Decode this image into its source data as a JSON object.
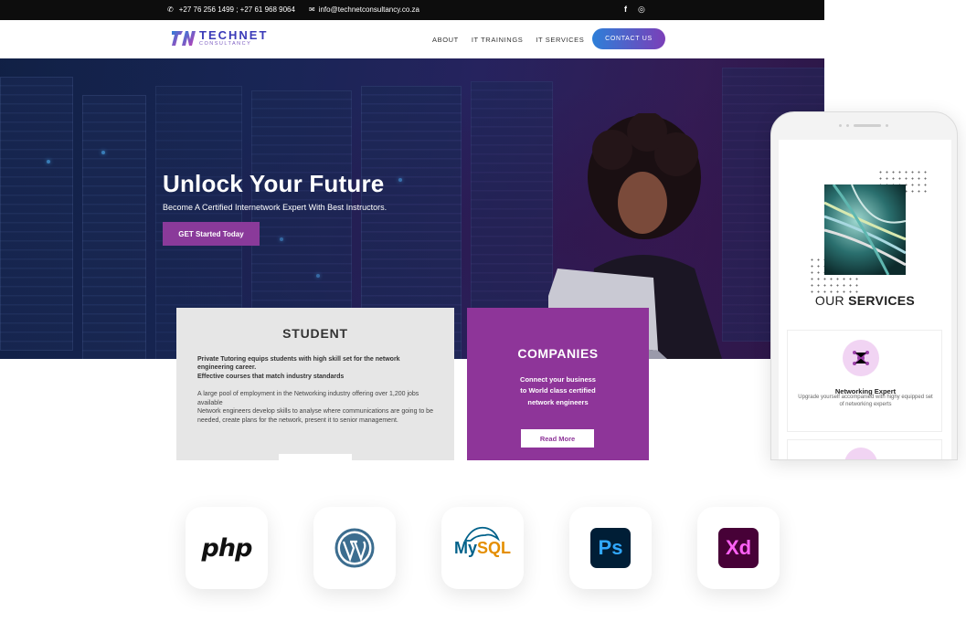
{
  "topbar": {
    "phone": "+27 76 256 1499 ; +27 61 968 9064",
    "email": "info@technetconsultancy.co.za",
    "social": [
      "f",
      "◎"
    ]
  },
  "brand": {
    "name": "TECHNET",
    "tagline": "CONSULTANCY"
  },
  "nav": {
    "items": [
      "ABOUT",
      "IT TRAININGS",
      "IT SERVICES"
    ],
    "cta": "CONTACT US"
  },
  "hero": {
    "title": "Unlock Your Future",
    "subtitle": "Become A Certified Internetwork Expert With Best Instructors.",
    "button": "GET Started Today"
  },
  "student": {
    "title": "STUDENT",
    "bold_line1": "Private Tutoring equips students with high skill set for the network engineering career.",
    "bold_line2": "Effective courses that match industry standards",
    "para1": "A large pool of employment in the Networking industry offering over 1,200 jobs available",
    "para2": "Network engineers develop skills to analyse where communications are going to be needed, create plans for the network, present it to senior management."
  },
  "companies": {
    "title": "COMPANIES",
    "line1": "Connect your business",
    "line2": "to World class certified",
    "line3": "network engineers",
    "button": "Read More"
  },
  "mobile": {
    "services_title_light": "OUR ",
    "services_title_bold": "SERVICES",
    "service_name": "Networking Expert",
    "service_desc": "Upgrade yourself accompanied with highy equipped set of networking experts"
  },
  "tech_stack": {
    "php": "php",
    "mysql_my": "My",
    "mysql_sql": "SQL",
    "ps": "Ps",
    "xd": "Xd"
  },
  "colors": {
    "accent_purple": "#8e3599",
    "cta_gradient_start": "#2d7fd8",
    "cta_gradient_end": "#7b3fb8",
    "topbar": "#0d0d0d"
  }
}
